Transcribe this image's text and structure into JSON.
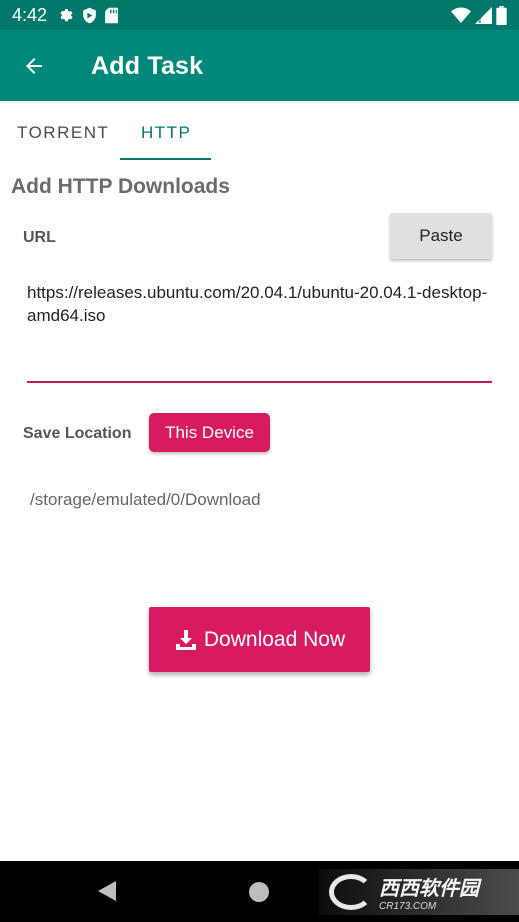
{
  "status_bar": {
    "time": "4:42",
    "icons": [
      "gear-icon",
      "shield-icon",
      "sd-card-icon",
      "wifi-icon",
      "signal-icon",
      "battery-icon"
    ]
  },
  "app_bar": {
    "title": "Add Task",
    "back_icon": "arrow-left-icon"
  },
  "tabs": [
    {
      "label": "TORRENT",
      "selected": false
    },
    {
      "label": "HTTP",
      "selected": true
    }
  ],
  "form": {
    "section_title": "Add HTTP Downloads",
    "url_label": "URL",
    "paste_label": "Paste",
    "url_value": "https://releases.ubuntu.com/20.04.1/ubuntu-20.04.1-desktop-amd64.iso",
    "save_location_label": "Save Location",
    "device_button_label": "This Device",
    "save_path": "/storage/emulated/0/Download",
    "download_button_label": "Download Now",
    "download_icon": "download-icon"
  },
  "nav_bar": {
    "icons": [
      "back-triangle-icon",
      "home-circle-icon"
    ]
  },
  "watermark": {
    "main_text": "西西软件园",
    "sub_text": "CR173.COM"
  },
  "colors": {
    "primary": "#00897b",
    "primary_dark": "#00796b",
    "accent": "#d81b60",
    "underline": "#c2185b"
  }
}
